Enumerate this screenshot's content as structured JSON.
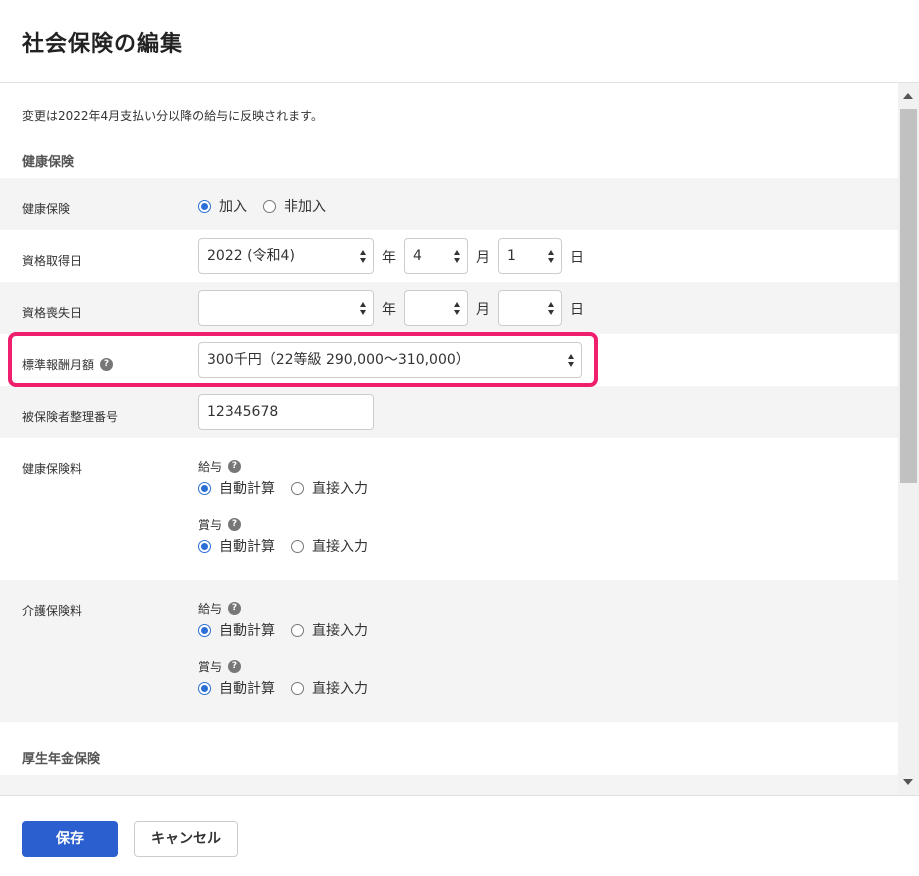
{
  "modal": {
    "title": "社会保険の編集"
  },
  "notice": "変更は2022年4月支払い分以降の給与に反映されます。",
  "health_section": {
    "title": "健康保険",
    "enrollment": {
      "label": "健康保険",
      "options": [
        "加入",
        "非加入"
      ],
      "selected": "加入"
    },
    "acquisition_date": {
      "label": "資格取得日",
      "year": "2022 (令和4)",
      "month": "4",
      "day": "1",
      "unit_year": "年",
      "unit_month": "月",
      "unit_day": "日"
    },
    "loss_date": {
      "label": "資格喪失日",
      "year": "",
      "month": "",
      "day": "",
      "unit_year": "年",
      "unit_month": "月",
      "unit_day": "日"
    },
    "standard_monthly": {
      "label": "標準報酬月額",
      "value": "300千円（22等級 290,000〜310,000）"
    },
    "insured_number": {
      "label": "被保険者整理番号",
      "value": "12345678"
    },
    "premium": {
      "label": "健康保険料",
      "salary": {
        "label": "給与",
        "options": [
          "自動計算",
          "直接入力"
        ],
        "selected": "自動計算"
      },
      "bonus": {
        "label": "賞与",
        "options": [
          "自動計算",
          "直接入力"
        ],
        "selected": "自動計算"
      }
    },
    "care_premium": {
      "label": "介護保険料",
      "salary": {
        "label": "給与",
        "options": [
          "自動計算",
          "直接入力"
        ],
        "selected": "自動計算"
      },
      "bonus": {
        "label": "賞与",
        "options": [
          "自動計算",
          "直接入力"
        ],
        "selected": "自動計算"
      }
    }
  },
  "pension_section": {
    "title": "厚生年金保険"
  },
  "help_icon_glyph": "?",
  "footer": {
    "save_label": "保存",
    "cancel_label": "キャンセル"
  },
  "colors": {
    "primary": "#2b5fcf",
    "highlight": "#ef1f6e",
    "radio": "#2a6fd6"
  }
}
